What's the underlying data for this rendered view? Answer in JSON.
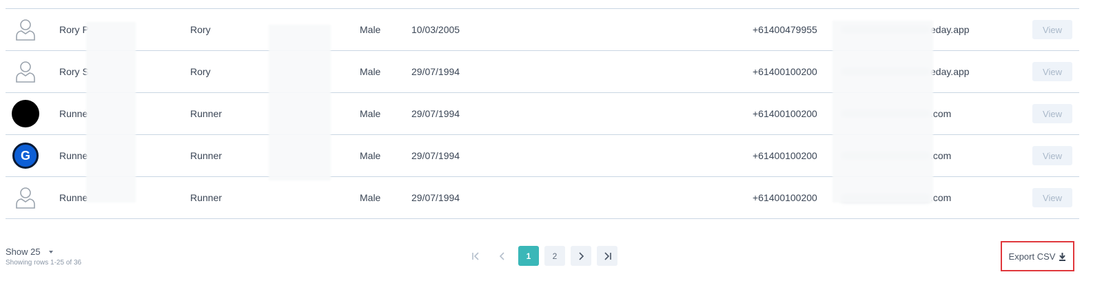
{
  "rows": [
    {
      "avatar": "user-outline-icon",
      "name": "Rory P",
      "preferred": "Rory",
      "gender": "Male",
      "dob": "10/03/2005",
      "phone": "+61400479955",
      "email_suffix": "eday.app",
      "view": "View"
    },
    {
      "avatar": "user-outline-icon",
      "name": "Rory S",
      "preferred": "Rory",
      "gender": "Male",
      "dob": "29/07/1994",
      "phone": "+61400100200",
      "email_suffix": "eday.app",
      "view": "View"
    },
    {
      "avatar": "black-circle-avatar",
      "name": "Runne",
      "preferred": "Runner",
      "gender": "Male",
      "dob": "29/07/1994",
      "phone": "+61400100200",
      "email_suffix": ".com",
      "view": "View"
    },
    {
      "avatar": "g-logo-avatar",
      "name": "Runne",
      "preferred": "Runner",
      "gender": "Male",
      "dob": "29/07/1994",
      "phone": "+61400100200",
      "email_suffix": ".com",
      "view": "View"
    },
    {
      "avatar": "user-outline-icon",
      "name": "Runne",
      "preferred": "Runner",
      "gender": "Male",
      "dob": "29/07/1994",
      "phone": "+61400100200",
      "email_suffix": ".com",
      "view": "View"
    }
  ],
  "avatar_letter": "G",
  "footer": {
    "show_label": "Show 25",
    "showing_rows": "Showing rows 1-25 of 36",
    "pages": [
      "1",
      "2"
    ],
    "active_page": "1",
    "export_label": "Export CSV"
  },
  "colors": {
    "accent": "#3ab7b8",
    "highlight": "#e0373c",
    "avatar_blue": "#0d5fd6"
  }
}
